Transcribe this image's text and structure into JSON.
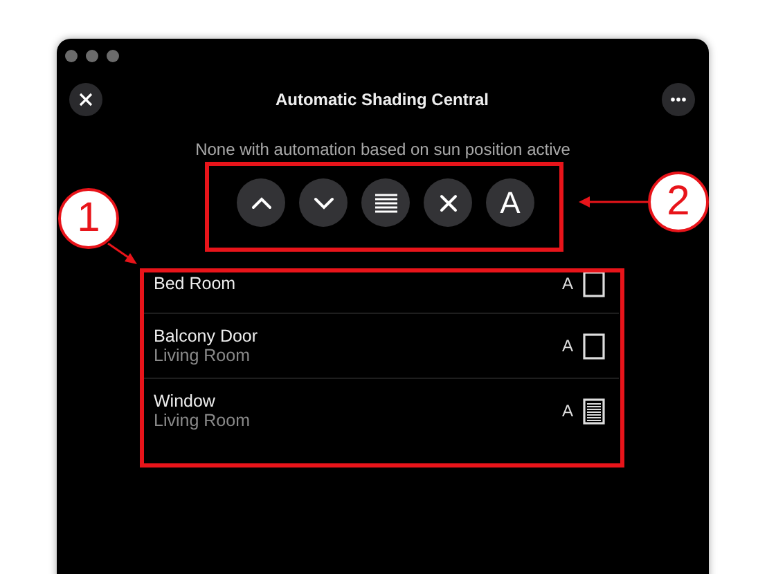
{
  "window": {
    "title": "Automatic Shading Central"
  },
  "status": "None with automation based on sun position active",
  "actions": [
    {
      "kind": "up"
    },
    {
      "kind": "down"
    },
    {
      "kind": "shade"
    },
    {
      "kind": "stop"
    },
    {
      "kind": "auto",
      "label": "A"
    }
  ],
  "devices": [
    {
      "name": "Bed Room",
      "mode": "A",
      "closed": false
    },
    {
      "name": "Balcony Door",
      "room": "Living Room",
      "mode": "A",
      "closed": false
    },
    {
      "name": "Window",
      "room": "Living Room",
      "mode": "A",
      "closed": true
    }
  ],
  "annotations": [
    {
      "label": "1"
    },
    {
      "label": "2"
    }
  ]
}
